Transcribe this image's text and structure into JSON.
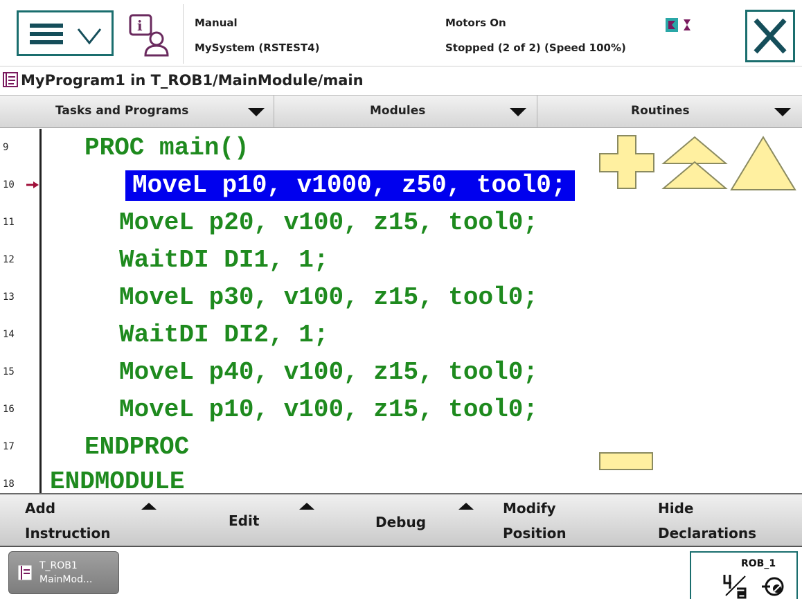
{
  "status": {
    "mode": "Manual",
    "system": "MySystem (RSTEST4)",
    "motors": "Motors On",
    "run_state": "Stopped (2 of 2) (Speed 100%)"
  },
  "header": {
    "menu_icon": "hamburger-menu-icon",
    "info_icon": "event-log-info-icon",
    "close_icon": "close-x-icon",
    "robot_icons": "mechanical-units-icon"
  },
  "program": {
    "title": "MyProgram1 in T_ROB1/MainModule/main"
  },
  "selectors": {
    "tasks": "Tasks and Programs",
    "modules": "Modules",
    "routines": "Routines"
  },
  "code_lines": [
    {
      "num": "9",
      "text": "PROC main()"
    },
    {
      "num": "10",
      "text": "MoveL p10, v1000, z50, tool0;"
    },
    {
      "num": "11",
      "text": "MoveL p20, v100, z15, tool0;"
    },
    {
      "num": "12",
      "text": "WaitDI DI1, 1;"
    },
    {
      "num": "13",
      "text": "MoveL p30, v100, z15, tool0;"
    },
    {
      "num": "14",
      "text": "WaitDI DI2, 1;"
    },
    {
      "num": "15",
      "text": "MoveL p40, v100, z15, tool0;"
    },
    {
      "num": "16",
      "text": "MoveL p10, v100, z15, tool0;"
    },
    {
      "num": "17",
      "text": "ENDPROC"
    },
    {
      "num": "18",
      "text": "ENDMODULE"
    }
  ],
  "highlighted_line": "10",
  "commands": {
    "add_1": "Add",
    "add_2": "Instruction",
    "edit": "Edit",
    "debug": "Debug",
    "modify_1": "Modify",
    "modify_2": "Position",
    "hide_1": "Hide",
    "hide_2": "Declarations"
  },
  "taskbar": {
    "task_line1": "T_ROB1",
    "task_line2": "MainMod...",
    "rob_name": "ROB_1",
    "rob_ratio_icon": "quick-set-increment-icon"
  },
  "colors": {
    "code_green": "#1e8a1e",
    "highlight_blue": "#0000ee",
    "control_yellow": "#fff0a0",
    "accent_teal": "#1a6e6e"
  }
}
